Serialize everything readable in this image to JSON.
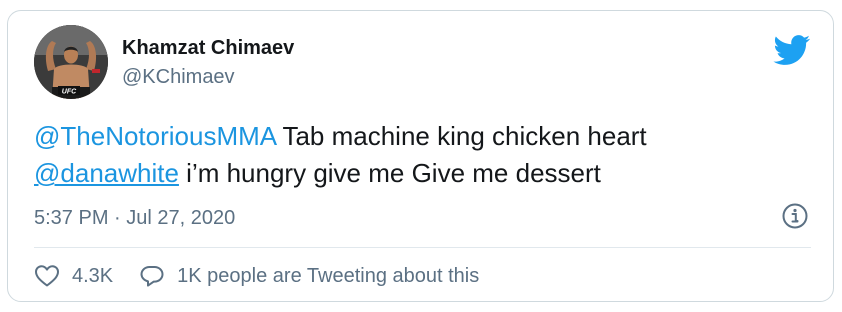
{
  "author": {
    "name": "Khamzat Chimaev",
    "handle": "@KChimaev",
    "avatar_badge": "UFC"
  },
  "tweet": {
    "mention1": "@TheNotoriousMMA",
    "text1": " Tab machine king chicken heart",
    "mention2": "@danawhite",
    "text2": " i’m hungry give me Give me dessert"
  },
  "timestamp": "5:37 PM · Jul 27, 2020",
  "actions": {
    "likes": "4.3K",
    "conversation": "1K people are Tweeting about this"
  },
  "icons": {
    "brand": "twitter-bird-icon",
    "info": "info-icon",
    "like": "heart-icon",
    "reply": "speech-bubble-icon"
  },
  "colors": {
    "brand": "#1da1f2",
    "link": "#1b95e0",
    "text": "#14171a",
    "muted": "#5b7083",
    "border": "#cfd9de"
  }
}
